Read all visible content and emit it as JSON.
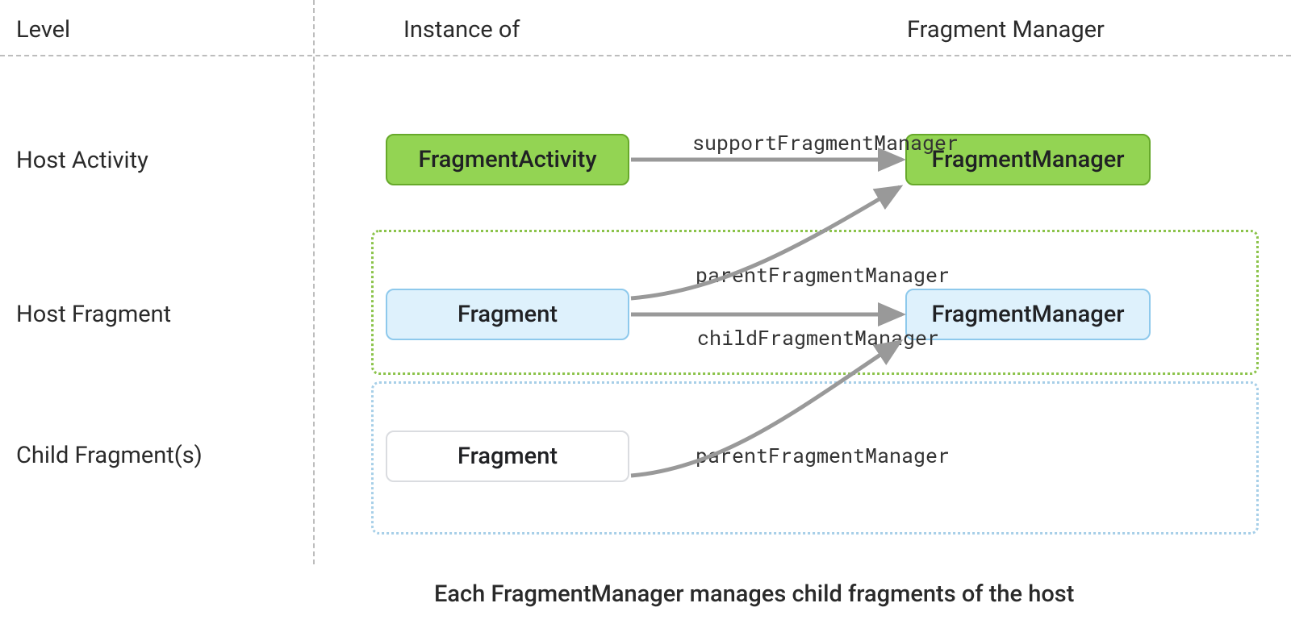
{
  "headers": {
    "level": "Level",
    "instance_of": "Instance of",
    "fragment_manager": "Fragment Manager"
  },
  "rows": {
    "host_activity": "Host Activity",
    "host_fragment": "Host Fragment",
    "child_fragments": "Child Fragment(s)"
  },
  "nodes": {
    "fragment_activity": "FragmentActivity",
    "fm_activity": "FragmentManager",
    "fragment_host": "Fragment",
    "fm_host": "FragmentManager",
    "fragment_child": "Fragment"
  },
  "edges": {
    "support_fm": "supportFragmentManager",
    "parent_fm_host": "parentFragmentManager",
    "child_fm": "childFragmentManager",
    "parent_fm_child": "parentFragmentManager"
  },
  "caption": "Each FragmentManager manages child fragments of the host",
  "colors": {
    "green_fill": "#93d453",
    "green_border": "#67a92b",
    "blue_fill": "#def1fc",
    "blue_border": "#8ec9ec",
    "arrow": "#999999"
  }
}
